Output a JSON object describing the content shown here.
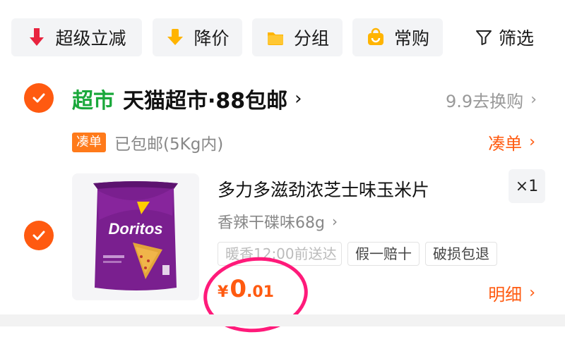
{
  "filters": {
    "chips": [
      {
        "label": "超级立减",
        "icon": "red-down-arrow-icon",
        "color": "#e8233e"
      },
      {
        "label": "降价",
        "icon": "price-drop-icon",
        "color": "#ffb400"
      },
      {
        "label": "分组",
        "icon": "folder-icon",
        "color": "#ffb400"
      },
      {
        "label": "常购",
        "icon": "shopping-bag-icon",
        "color": "#ffb400"
      }
    ],
    "filter_label": "筛选",
    "filter_icon": "funnel-icon"
  },
  "store": {
    "tag": "超市",
    "name": "天猫超市·88包邮",
    "chevron": "›",
    "exchange_label": "9.9去换购",
    "exchange_chevron": "›"
  },
  "shipping": {
    "badge": "凑单",
    "text": "已包邮(5Kg内)",
    "action": "凑单",
    "action_chevron": "›"
  },
  "product": {
    "brand_text": "Doritos",
    "title": "多力多滋劲浓芝士味玉米片",
    "quantity": "×1",
    "spec": "香辣干碟味68g",
    "spec_chevron": "›",
    "tags": [
      "暖香12:00前送达",
      "假一赔十",
      "破损包退"
    ],
    "price": {
      "symbol": "¥",
      "integer": "0",
      "decimal": ".01"
    },
    "detail_label": "明细",
    "detail_chevron": "›"
  },
  "colors": {
    "accent": "#ff5a10",
    "store_green": "#1aa83b",
    "highlight_circle": "#ff1a7a"
  }
}
